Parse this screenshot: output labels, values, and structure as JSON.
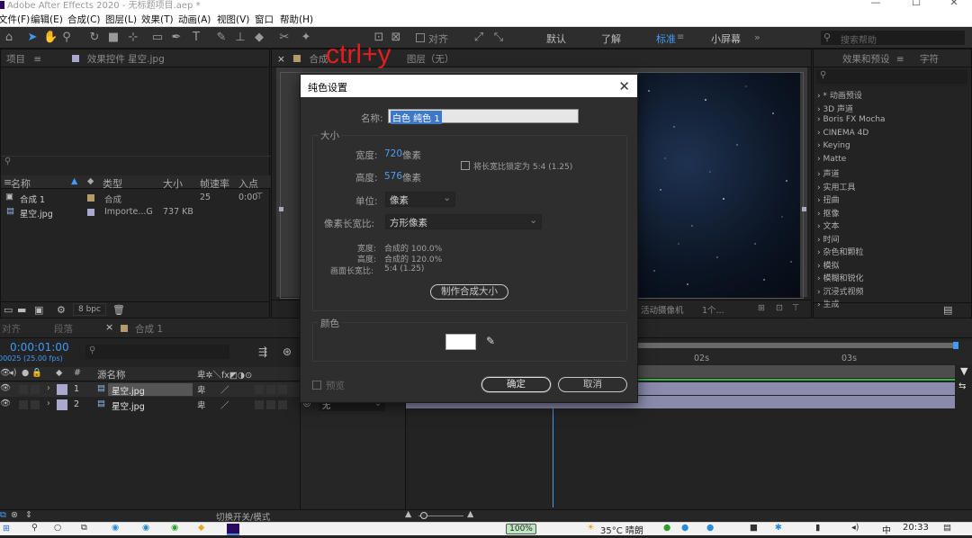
{
  "app": {
    "title": "Adobe After Effects 2020 - 无标题项目.aep *",
    "minimize": "—",
    "maximize": "☐",
    "close": "✕"
  },
  "menu": [
    "文件(F)",
    "编辑(E)",
    "合成(C)",
    "图层(L)",
    "效果(T)",
    "动画(A)",
    "视图(V)",
    "窗口",
    "帮助(H)"
  ],
  "toolbar": {
    "snap_label": "对齐",
    "workspaces": [
      "默认",
      "了解",
      "标准",
      "小屏幕"
    ],
    "active_workspace": "标准",
    "search_placeholder": "搜索帮助"
  },
  "annotation": {
    "text": "ctrl+y",
    "color": "#e02020"
  },
  "project_panel": {
    "tab_project": "项目",
    "tab_effects": "效果控件 星空.jpg",
    "columns": [
      "名称",
      "类型",
      "大小",
      "帧速率",
      "入点"
    ],
    "items": [
      {
        "name": "合成 1",
        "type": "合成",
        "size": "",
        "fps": "25",
        "in": "0:00",
        "color": "#b59b6a"
      },
      {
        "name": "星空.jpg",
        "type": "Importe...G",
        "size": "737 KB",
        "fps": "",
        "in": "",
        "color": "#a9a9d0"
      }
    ],
    "bpc": "8 bpc"
  },
  "comp_panel": {
    "tab": "合成",
    "layer_tab": "图层（无）",
    "camera": "活动摄像机",
    "views": "1个..."
  },
  "effects_panel": {
    "tab": "效果和预设",
    "tab2": "字符",
    "items": [
      "* 动画预设",
      "3D 声道",
      "Boris FX Mocha",
      "CINEMA 4D",
      "Keying",
      "Matte",
      "声道",
      "实用工具",
      "扭曲",
      "抠像",
      "文本",
      "时间",
      "杂色和颗粒",
      "模拟",
      "模糊和锐化",
      "沉浸式视频",
      "生成"
    ]
  },
  "dialog": {
    "title": "纯色设置",
    "name_label": "名称:",
    "name_value": "白色 纯色 1",
    "size_group": "大小",
    "width_label": "宽度:",
    "width_value": "720",
    "height_label": "高度:",
    "height_value": "576",
    "pixel_unit": "像素",
    "lock_aspect": "将长宽比锁定为 5:4 (1.25)",
    "unit_label": "单位:",
    "unit_value": "像素",
    "par_label": "像素长宽比:",
    "par_value": "方形像素",
    "info_width_label": "宽度:",
    "info_width_value": "合成的 100.0%",
    "info_height_label": "高度:",
    "info_height_value": "合成的 120.0%",
    "frame_aspect_label": "画面长宽比:",
    "frame_aspect_value": "5:4 (1.25)",
    "make_comp_size": "制作合成大小",
    "color_group": "颜色",
    "swatch_color": "#ffffff",
    "preview": "预览",
    "ok": "确定",
    "cancel": "取消"
  },
  "timeline": {
    "tab_align": "对齐",
    "tab_paragraph": "段落",
    "tab_comp": "合成 1",
    "timecode": "0:00:01:00",
    "frame_info": "00025 (25.00 fps)",
    "col_source": "源名称",
    "layers": [
      {
        "num": "1",
        "name": "星空.jpg"
      },
      {
        "num": "2",
        "name": "星空.jpg"
      }
    ],
    "mode_value": "无",
    "ruler": [
      "02s",
      "03s"
    ],
    "toggle_label": "切换开关/模式"
  },
  "taskbar": {
    "battery": "100%",
    "weather": "35°C 晴朗",
    "ime": "中",
    "time": "20:33"
  }
}
